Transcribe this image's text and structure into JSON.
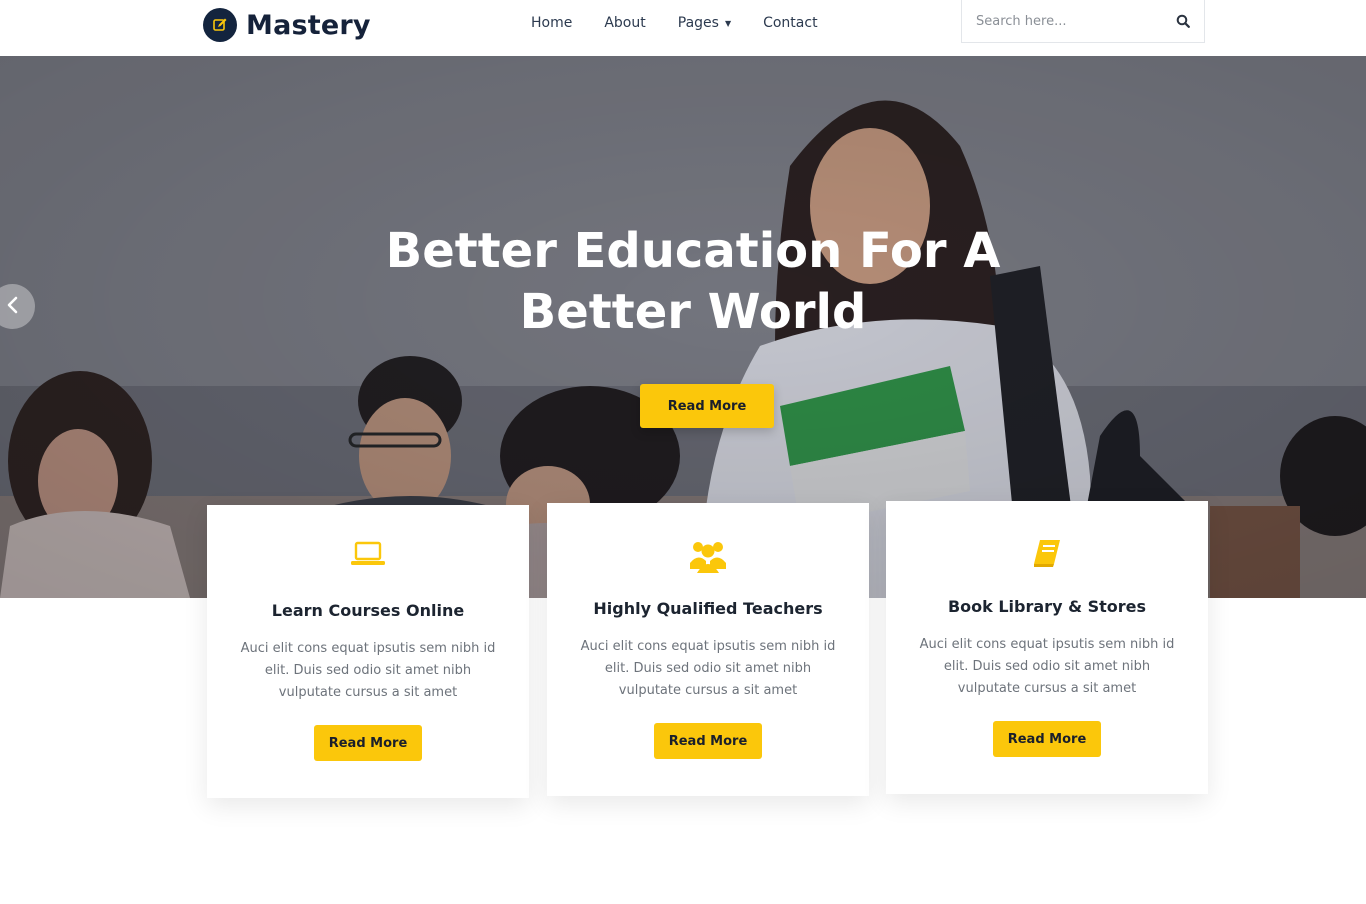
{
  "brand": {
    "name": "Mastery",
    "logo_icon": "edit-square-icon",
    "navy": "#13243e"
  },
  "nav": {
    "items": [
      {
        "label": "Home"
      },
      {
        "label": "About"
      },
      {
        "label": "Pages",
        "dropdown": true
      },
      {
        "label": "Contact"
      }
    ]
  },
  "search": {
    "placeholder": "Search here...",
    "value": "",
    "icon": "search-icon"
  },
  "hero": {
    "title": "Better Education For A Better World",
    "button_label": "Read More",
    "prev_icon": "chevron-left-icon"
  },
  "theme": {
    "accent": "#fbc70b",
    "heading": "#1c2430",
    "body_text": "#6d737b"
  },
  "cards": [
    {
      "icon": "laptop-icon",
      "title": "Learn Courses Online",
      "text": "Auci elit cons equat ipsutis sem nibh id elit. Duis sed odio sit amet nibh vulputate cursus a sit amet",
      "button_label": "Read More"
    },
    {
      "icon": "users-icon",
      "title": "Highly Qualified Teachers",
      "text": "Auci elit cons equat ipsutis sem nibh id elit. Duis sed odio sit amet nibh vulputate cursus a sit amet",
      "button_label": "Read More"
    },
    {
      "icon": "book-icon",
      "title": "Book Library & Stores",
      "text": "Auci elit cons equat ipsutis sem nibh id elit. Duis sed odio sit amet nibh vulputate cursus a sit amet",
      "button_label": "Read More"
    }
  ]
}
